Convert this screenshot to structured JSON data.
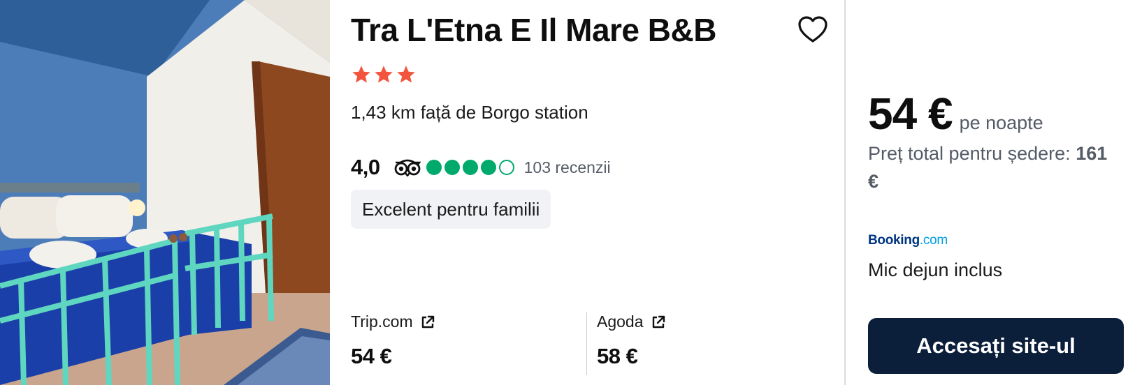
{
  "hotel": {
    "name": "Tra L'Etna E Il Mare B&B",
    "star_count": 3,
    "distance": "1,43 km față de Borgo station",
    "rating": "4,0",
    "bubble_rating": 4,
    "bubble_max": 5,
    "reviews": "103 recenzii",
    "tag": "Excelent pentru familii"
  },
  "offers": [
    {
      "provider": "Trip.com",
      "price": "54 €"
    },
    {
      "provider": "Agoda",
      "price": "58 €"
    }
  ],
  "side": {
    "price": "54 €",
    "per_night": "pe noapte",
    "total_label": "Preț total pentru ședere:",
    "total_value": "161 €",
    "provider_logo_main": "Booking",
    "provider_logo_suffix": ".com",
    "breakfast": "Mic dejun inclus",
    "cta": "Accesați site-ul"
  },
  "colors": {
    "star": "#f2543d",
    "bubble": "#00aa6c",
    "cta_bg": "#0b1f3b",
    "booking_blue": "#003580",
    "booking_light": "#009fe3"
  },
  "icons": {
    "favorite": "heart-icon",
    "star": "star-icon",
    "tripadvisor": "tripadvisor-owl-icon",
    "external": "external-link-icon"
  }
}
